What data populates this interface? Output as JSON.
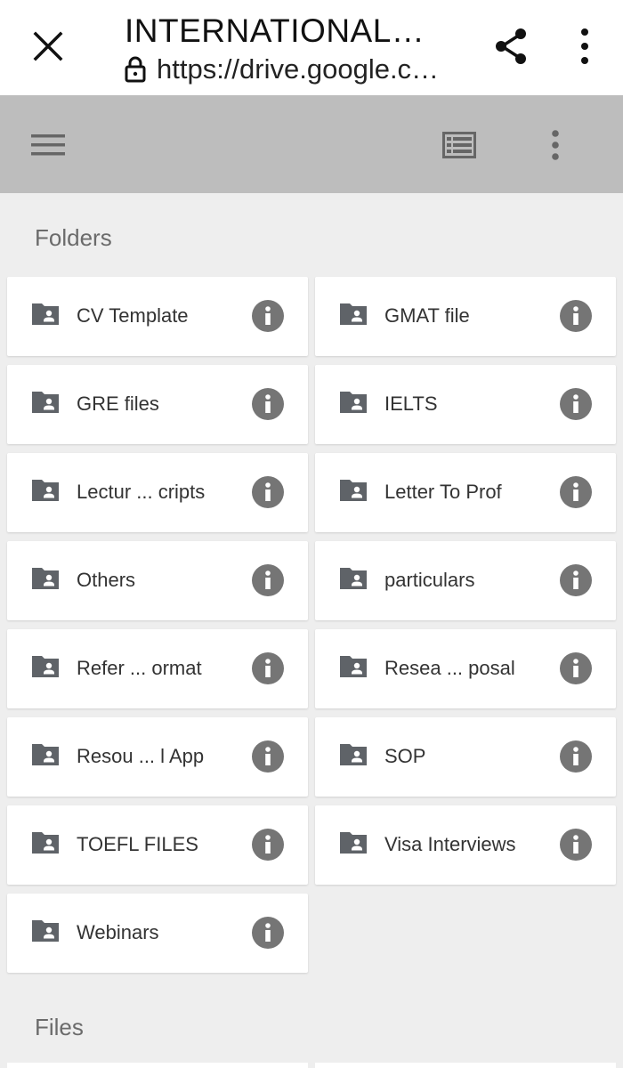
{
  "browser": {
    "title": "INTERNATIONAL…",
    "url": "https://drive.google.c…"
  },
  "sections": {
    "folders_label": "Folders",
    "files_label": "Files"
  },
  "folders": [
    {
      "name": "CV Template"
    },
    {
      "name": "GMAT file"
    },
    {
      "name": "GRE files"
    },
    {
      "name": "IELTS"
    },
    {
      "name": "Lectur ... cripts"
    },
    {
      "name": "Letter To Prof"
    },
    {
      "name": "Others"
    },
    {
      "name": "particulars"
    },
    {
      "name": "Refer ... ormat"
    },
    {
      "name": "Resea ... posal"
    },
    {
      "name": "Resou ... l App"
    },
    {
      "name": "SOP"
    },
    {
      "name": "TOEFL FILES"
    },
    {
      "name": "Visa Interviews"
    },
    {
      "name": "Webinars"
    }
  ],
  "icons": {
    "close": "close-icon",
    "lock": "lock-icon",
    "share": "share-icon",
    "menu": "more-vert-icon",
    "hamburger": "hamburger-icon",
    "list_view": "list-view-icon",
    "folder": "shared-folder-icon",
    "info": "info-icon"
  },
  "colors": {
    "toolbar": "#bdbdbd",
    "background": "#eeeeee",
    "card": "#ffffff",
    "icon_gray": "#757575",
    "folder_gray": "#5f6368"
  }
}
